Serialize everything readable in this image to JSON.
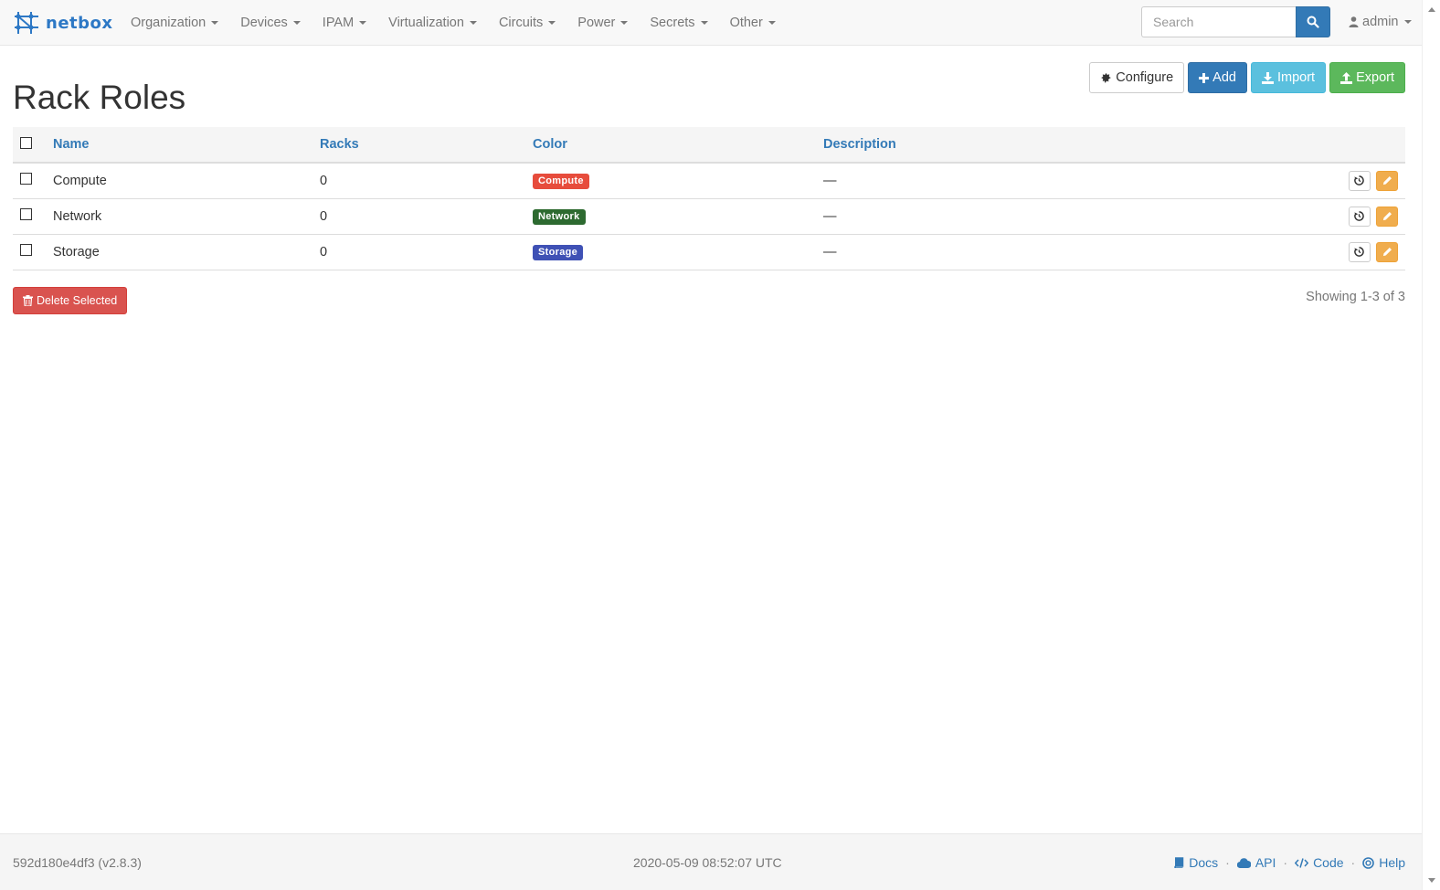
{
  "brand": {
    "name": "netbox"
  },
  "nav": {
    "items": [
      {
        "label": "Organization"
      },
      {
        "label": "Devices"
      },
      {
        "label": "IPAM"
      },
      {
        "label": "Virtualization"
      },
      {
        "label": "Circuits"
      },
      {
        "label": "Power"
      },
      {
        "label": "Secrets"
      },
      {
        "label": "Other"
      }
    ],
    "search_placeholder": "Search",
    "user": "admin"
  },
  "page": {
    "title": "Rack Roles",
    "actions": {
      "configure": "Configure",
      "add": "Add",
      "import": "Import",
      "export": "Export"
    }
  },
  "table": {
    "columns": {
      "name": "Name",
      "racks": "Racks",
      "color": "Color",
      "description": "Description"
    },
    "rows": [
      {
        "name": "Compute",
        "racks": "0",
        "color_label": "Compute",
        "color": "#e74c3c",
        "description": "—"
      },
      {
        "name": "Network",
        "racks": "0",
        "color_label": "Network",
        "color": "#2d6a30",
        "description": "—"
      },
      {
        "name": "Storage",
        "racks": "0",
        "color_label": "Storage",
        "color": "#3f51b5",
        "description": "—"
      }
    ]
  },
  "delete_selected": "Delete Selected",
  "pagination": {
    "showing": "Showing 1-3 of 3"
  },
  "footer": {
    "version": "592d180e4df3 (v2.8.3)",
    "timestamp": "2020-05-09 08:52:07 UTC",
    "links": {
      "docs": "Docs",
      "api": "API",
      "code": "Code",
      "help": "Help"
    },
    "separator": "·"
  }
}
